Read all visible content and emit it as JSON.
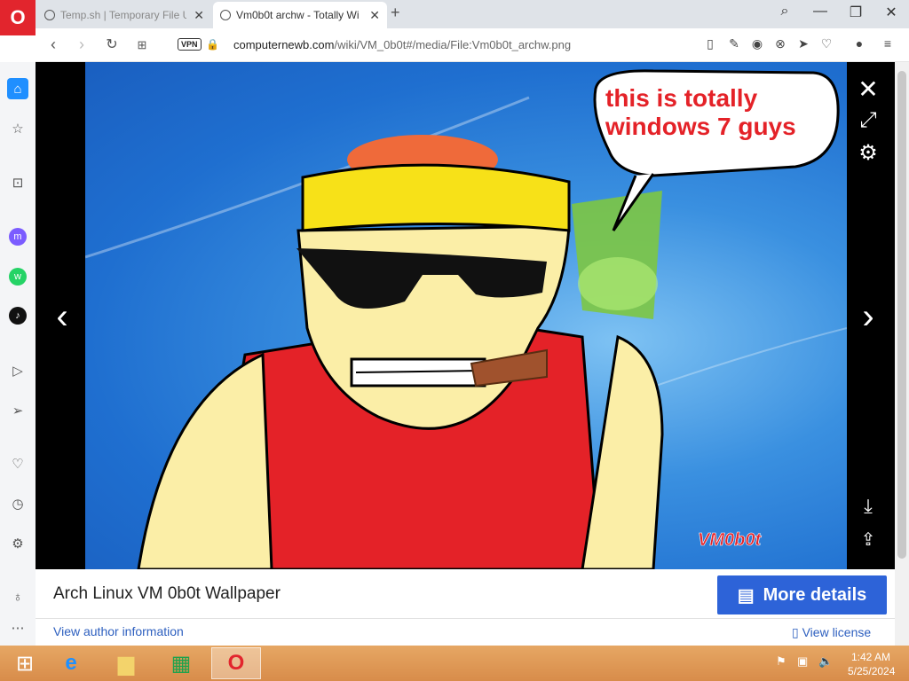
{
  "browser": {
    "tabs": [
      {
        "title": "Temp.sh | Temporary File U"
      },
      {
        "title": "Vm0b0t archw - Totally Wi"
      }
    ],
    "new_tab": "+",
    "url_host": "computernewb.com",
    "url_path": "/wiki/VM_0b0t#/media/File:Vm0b0t_archw.png",
    "vpn_label": "VPN"
  },
  "lightbox": {
    "speech_bubble_text": "this is totally windows 7 guys",
    "signature": "VM0b0t"
  },
  "caption": {
    "title": "Arch Linux VM 0b0t Wallpaper",
    "more_details_label": "More details",
    "author_link": "View author information",
    "license_link": "View license"
  },
  "taskbar": {
    "time": "1:42 AM",
    "date": "5/25/2024"
  },
  "colors": {
    "accent": "#2d63d8",
    "opera_red": "#e2252d",
    "taskbar": "#d88c4a"
  }
}
